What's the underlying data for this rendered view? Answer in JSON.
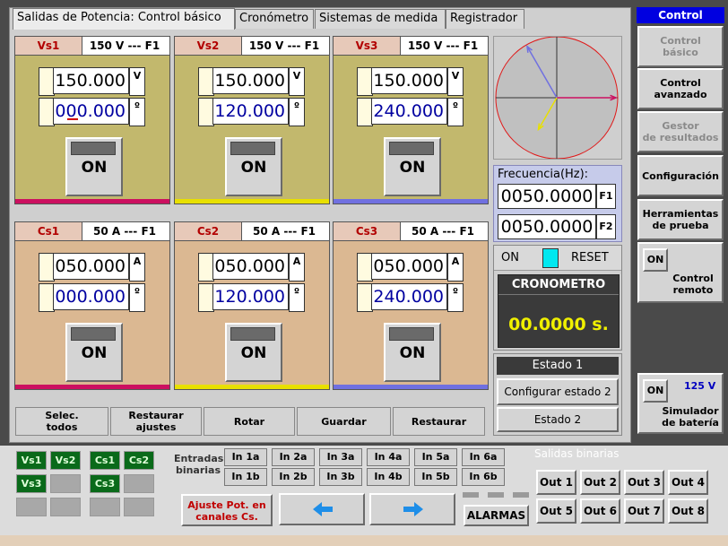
{
  "tabs": [
    "Salidas de Potencia: Control básico",
    "Cronómetro",
    "Sistemas de medida",
    "Registrador"
  ],
  "voltage_channels": [
    {
      "name": "Vs1",
      "range": "150 V --- F1",
      "magnitude": "150.000",
      "mag_unit": "V",
      "angle": "000.000",
      "angle_unit": "º",
      "button": "ON",
      "color": "#d4d4d4"
    },
    {
      "name": "Vs2",
      "range": "150 V --- F1",
      "magnitude": "150.000",
      "mag_unit": "V",
      "angle": "120.000",
      "angle_unit": "º",
      "button": "ON",
      "color": "#e8e000"
    },
    {
      "name": "Vs3",
      "range": "150 V --- F1",
      "magnitude": "150.000",
      "mag_unit": "V",
      "angle": "240.000",
      "angle_unit": "º",
      "button": "ON",
      "color": "#6f6fe0"
    }
  ],
  "current_channels": [
    {
      "name": "Cs1",
      "range": "50 A --- F1",
      "magnitude": "050.000",
      "mag_unit": "A",
      "angle": "000.000",
      "angle_unit": "º",
      "button": "ON"
    },
    {
      "name": "Cs2",
      "range": "50 A --- F1",
      "magnitude": "050.000",
      "mag_unit": "A",
      "angle": "120.000",
      "angle_unit": "º",
      "button": "ON"
    },
    {
      "name": "Cs3",
      "range": "50 A --- F1",
      "magnitude": "050.000",
      "mag_unit": "A",
      "angle": "240.000",
      "angle_unit": "º",
      "button": "ON"
    }
  ],
  "frequency": {
    "label": "Frecuencia(Hz):",
    "f1_value": "0050.0000",
    "f1_label": "F1",
    "f2_value": "0050.0000",
    "f2_label": "F2"
  },
  "chrono": {
    "on_label": "ON",
    "reset_label": "RESET",
    "title": "CRONOMETRO",
    "value": "00.0000 s."
  },
  "state": {
    "title": "Estado 1",
    "configure": "Configurar estado 2",
    "next": "Estado 2"
  },
  "bottom_buttons": [
    "Selec.\ntodos",
    "Restaurar\najustes",
    "Rotar",
    "Guardar",
    "Restaurar"
  ],
  "sidebar": {
    "header": "Control",
    "items": [
      "Control\nbásico",
      "Control\navanzado",
      "Gestor\nde resultados",
      "Configuración",
      "Herramientas\nde prueba"
    ],
    "remote_on": "ON",
    "remote_label": "Control\nremoto",
    "battery_on": "ON",
    "battery_voltage": "125 V",
    "battery_label": "Simulador\nde batería"
  },
  "lamps": [
    "Vs1",
    "Vs2",
    "Cs1",
    "Cs2",
    "Vs3",
    "",
    "Cs3",
    "",
    "",
    "",
    "",
    ""
  ],
  "inputs": {
    "label": "Entradas\nbinarias",
    "row1": [
      "In 1a",
      "In 2a",
      "In 3a",
      "In 4a",
      "In 5a",
      "In 6a"
    ],
    "row2": [
      "In 1b",
      "In 2b",
      "In 3b",
      "In 4b",
      "In 5b",
      "In 6b"
    ]
  },
  "outputs": {
    "label": "Salidas binarias",
    "row1": [
      "Out 1",
      "Out 2",
      "Out 3",
      "Out 4"
    ],
    "row2": [
      "Out 5",
      "Out 6",
      "Out 7",
      "Out 8"
    ]
  },
  "adjust_label": "Ajuste Pot. en\ncanales Cs.",
  "alarms_label": "ALARMAS",
  "colors": {
    "voltage_panel": "#c2b86d",
    "current_panel": "#dbb892",
    "bar_red": "#cc1060",
    "bar_yellow": "#e8e000",
    "bar_blue": "#7070e0",
    "lamp_green": "#0a6a1a",
    "chrono_value": "#f0f000"
  },
  "phasor": {
    "vectors": [
      {
        "angle_deg": 0,
        "magnitude": 1.0,
        "color": "#cc1060"
      },
      {
        "angle_deg": 120,
        "magnitude": 1.0,
        "color": "#7070e0"
      },
      {
        "angle_deg": 240,
        "magnitude": 0.62,
        "color": "#e8e000"
      }
    ]
  }
}
